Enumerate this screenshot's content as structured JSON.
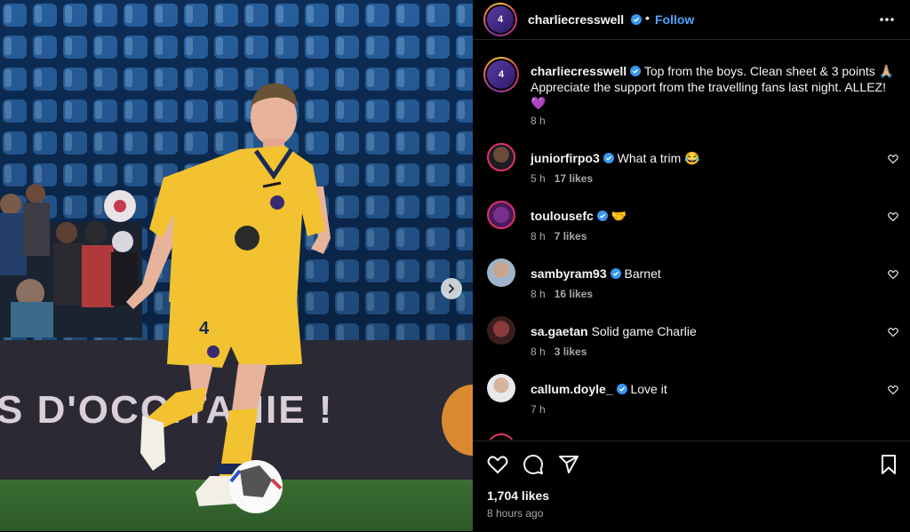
{
  "header": {
    "username": "charliecresswell",
    "follow_label": "Follow",
    "separator": "•",
    "avatar_number": "4"
  },
  "caption": {
    "username": "charliecresswell",
    "text": "Top from the boys. Clean sheet & 3 points 🙏🏼 Appreciate the support from the travelling fans last night. ALLEZ!💜",
    "time": "8 h"
  },
  "comments": [
    {
      "username": "juniorfirpo3",
      "verified": true,
      "text": "What a trim 😂",
      "time": "5 h",
      "likes": "17 likes"
    },
    {
      "username": "toulousefc",
      "verified": true,
      "text": "🤝",
      "time": "8 h",
      "likes": "7 likes"
    },
    {
      "username": "sambyram93",
      "verified": true,
      "text": "Barnet",
      "time": "8 h",
      "likes": "16 likes"
    },
    {
      "username": "sa.gaetan",
      "verified": false,
      "text": "Solid game Charlie",
      "time": "8 h",
      "likes": "3 likes"
    },
    {
      "username": "callum.doyle_",
      "verified": true,
      "text": "Love it",
      "time": "7 h",
      "likes": ""
    }
  ],
  "photo": {
    "board_text": "S D'OCCITANIE !",
    "shirt_number": "4"
  },
  "footer": {
    "likes": "1,704 likes",
    "time_ago": "8 hours ago"
  },
  "colors": {
    "accent": "#4da3ff",
    "verified": "#3897f0",
    "kit": "#f2c230"
  },
  "icons": [
    "verified-badge-icon",
    "more-options-icon",
    "heart-icon",
    "comment-icon",
    "share-icon",
    "bookmark-icon",
    "chevron-right-icon"
  ]
}
